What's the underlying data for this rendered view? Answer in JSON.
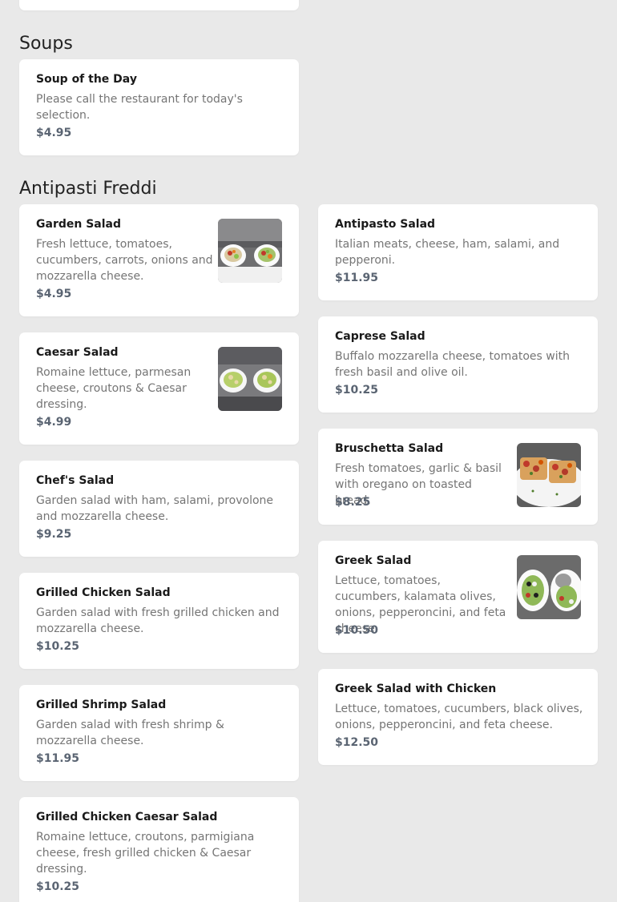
{
  "sections": {
    "soups": {
      "title": "Soups",
      "items": [
        {
          "name": "Soup of the Day",
          "desc": "Please call the restaurant for today's selection.",
          "price": "$4.95"
        }
      ]
    },
    "antipasti": {
      "title": "Antipasti Freddi",
      "items": [
        {
          "name": "Garden Salad",
          "desc": "Fresh lettuce, tomatoes, cucumbers, carrots, onions and mozzarella cheese.",
          "price": "$4.95",
          "image": "garden-salad-photo"
        },
        {
          "name": "Antipasto Salad",
          "desc": "Italian meats, cheese, ham, salami, and pepperoni.",
          "price": "$11.95"
        },
        {
          "name": "Caesar Salad",
          "desc": "Romaine lettuce, parmesan cheese, croutons & Caesar dressing.",
          "price": "$4.99",
          "image": "caesar-salad-photo"
        },
        {
          "name": "Caprese Salad",
          "desc": "Buffalo mozzarella cheese, tomatoes with fresh basil and olive oil.",
          "price": "$10.25"
        },
        {
          "name": "Chef's Salad",
          "desc": "Garden salad with ham, salami, provolone and mozzarella cheese.",
          "price": "$9.25"
        },
        {
          "name": "Bruschetta Salad",
          "desc": "Fresh tomatoes, garlic & basil with oregano on toasted bread.",
          "price": "$8.25",
          "image": "bruschetta-salad-photo"
        },
        {
          "name": "Grilled Chicken Salad",
          "desc": "Garden salad with fresh grilled chicken and mozzarella cheese.",
          "price": "$10.25"
        },
        {
          "name": "Greek Salad",
          "desc": "Lettuce, tomatoes, cucumbers, kalamata olives, onions, pepperoncini, and feta cheese.",
          "price": "$10.50",
          "image": "greek-salad-photo"
        },
        {
          "name": "Grilled Shrimp Salad",
          "desc": "Garden salad with fresh shrimp & mozzarella cheese.",
          "price": "$11.95"
        },
        {
          "name": "Greek Salad with Chicken",
          "desc": "Lettuce, tomatoes, cucumbers, black olives, onions, pepperoncini, and feta cheese.",
          "price": "$12.50"
        },
        {
          "name": "Grilled Chicken Caesar Salad",
          "desc": "Romaine lettuce, croutons, parmigiana cheese, fresh grilled chicken & Caesar dressing.",
          "price": "$10.25"
        }
      ]
    }
  }
}
